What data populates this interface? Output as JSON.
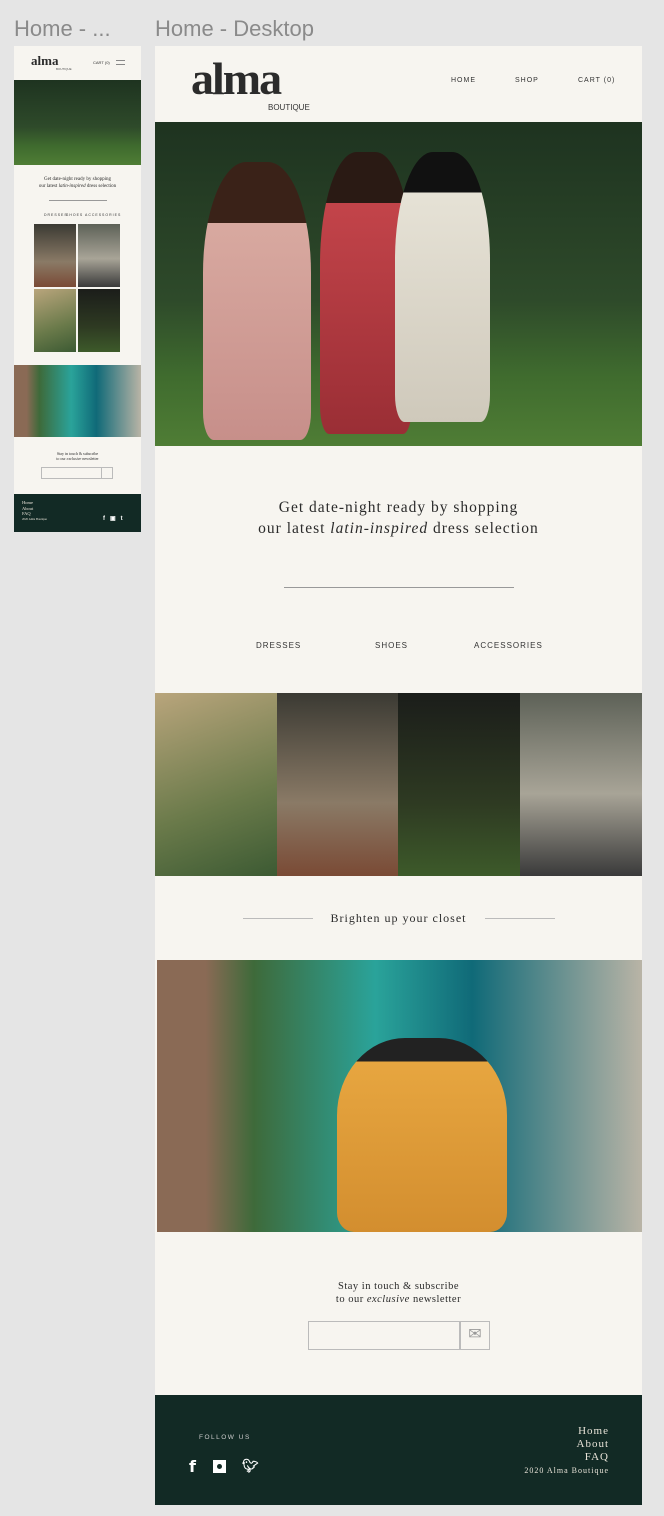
{
  "canvas": {
    "mobile_frame_label": "Home - ...",
    "desktop_frame_label": "Home - Desktop"
  },
  "brand": {
    "logo": "alma",
    "sub": "BOUTIQUE"
  },
  "nav": {
    "home": "HOME",
    "shop": "SHOP",
    "cart": "CART (0)"
  },
  "mobile": {
    "cart": "CART (0)",
    "menu_icon": "hamburger-icon"
  },
  "tagline": {
    "line1": "Get date-night ready by shopping",
    "line2_pre": "our latest ",
    "line2_em": "latin-inspired",
    "line2_post": " dress selection"
  },
  "categories": [
    "DRESSES",
    "SHOES",
    "ACCESSORIES"
  ],
  "section_title": "Brighten up your closet",
  "newsletter": {
    "line1": "Stay in touch & subscribe",
    "line2_pre": "to our ",
    "line2_em": "exclusive",
    "line2_post": " newsletter",
    "value": "",
    "icon": "envelope-icon"
  },
  "footer": {
    "follow": "FOLLOW US",
    "links": [
      "Home",
      "About",
      "FAQ"
    ],
    "copyright": "2020 Alma Boutique",
    "social": [
      "facebook-icon",
      "instagram-icon",
      "twitter-icon"
    ]
  },
  "colors": {
    "background": "#f7f5f0",
    "footer": "#122a25",
    "canvas": "#e5e5e5"
  }
}
